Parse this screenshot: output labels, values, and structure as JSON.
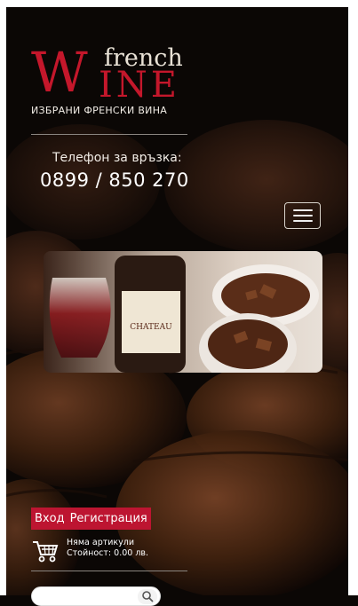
{
  "logo": {
    "brand_w": "W",
    "brand_french": "french",
    "brand_ine": "INE",
    "tagline": "ИЗБРАНИ ФРЕНСКИ ВИНА"
  },
  "contact": {
    "label": "Телефон за връзка:",
    "phone": "0899 / 850 270"
  },
  "auth": {
    "login": "Вход",
    "register": "Регистрация"
  },
  "cart": {
    "items": "Няма артикули",
    "total": "Стойност: 0.00 лв."
  },
  "search": {
    "placeholder": ""
  },
  "icons": {
    "menu": "hamburger-menu-icon",
    "cart": "shopping-cart-icon",
    "search": "search-icon"
  },
  "colors": {
    "accent": "#bd1531",
    "logo_red": "#c4172b",
    "background": "#0b0705"
  }
}
